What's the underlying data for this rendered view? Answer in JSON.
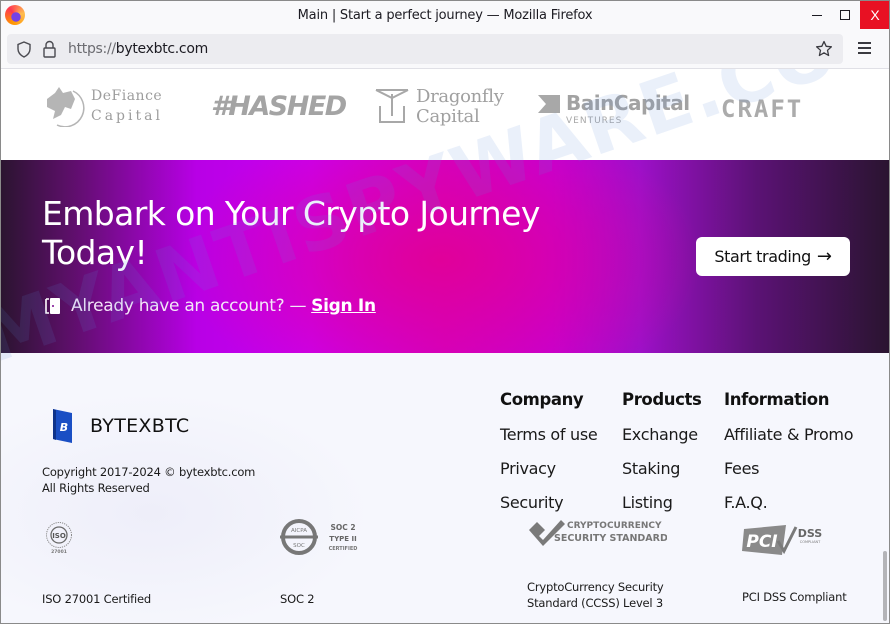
{
  "browser": {
    "window_title": "Main | Start a perfect journey — Mozilla Firefox",
    "url_scheme": "https://",
    "url_host": "bytexbtc.com",
    "close_label": "X"
  },
  "partners": {
    "defiance": {
      "line1": "DeFiance",
      "line2": "Capital"
    },
    "hashed": "#HASHED",
    "dragonfly": {
      "line1": "Dragonfly",
      "line2": "Capital"
    },
    "bain": {
      "line1": "BainCapital",
      "line2": "VENTURES"
    },
    "craft": "CRAFT"
  },
  "banner": {
    "title": "Embark on Your Crypto Journey Today!",
    "account_prompt": "Already have an account? —",
    "signin_label": "Sign In",
    "start_label": "Start trading",
    "start_arrow": "→"
  },
  "footer": {
    "brand_name": "BYTEXBTC",
    "brand_letter": "B",
    "copyright_line1": "Copyright 2017-2024 © bytexbtc.com",
    "copyright_line2": "All Rights Reserved",
    "columns": [
      {
        "heading": "Company",
        "links": [
          "Terms of use",
          "Privacy",
          "Security"
        ]
      },
      {
        "heading": "Products",
        "links": [
          "Exchange",
          "Staking",
          "Listing"
        ]
      },
      {
        "heading": "Information",
        "links": [
          "Affiliate & Promo",
          "Fees",
          "F.A.Q."
        ]
      }
    ],
    "certifications": [
      {
        "label": "ISO 27001 Certified",
        "badge_text": "ISO",
        "badge_sub": "27001"
      },
      {
        "label": "SOC 2",
        "badge_text": "SOC 2",
        "badge_sub1": "TYPE II",
        "badge_sub2": "CERTIFIED",
        "ring_top": "AICPA",
        "ring_bottom": "SOC"
      },
      {
        "label_line1": "CryptoCurrency Security",
        "label_line2": "Standard (CCSS) Level 3",
        "badge_line1": "CRYPTOCURRENCY",
        "badge_line2": "SECURITY STANDARD"
      },
      {
        "label": "PCI DSS Compliant",
        "badge_text": "PCI",
        "badge_sub": "DSS",
        "badge_sub2": "COMPLIANT"
      }
    ]
  },
  "watermark": "MYANTISPYWARE.COM"
}
